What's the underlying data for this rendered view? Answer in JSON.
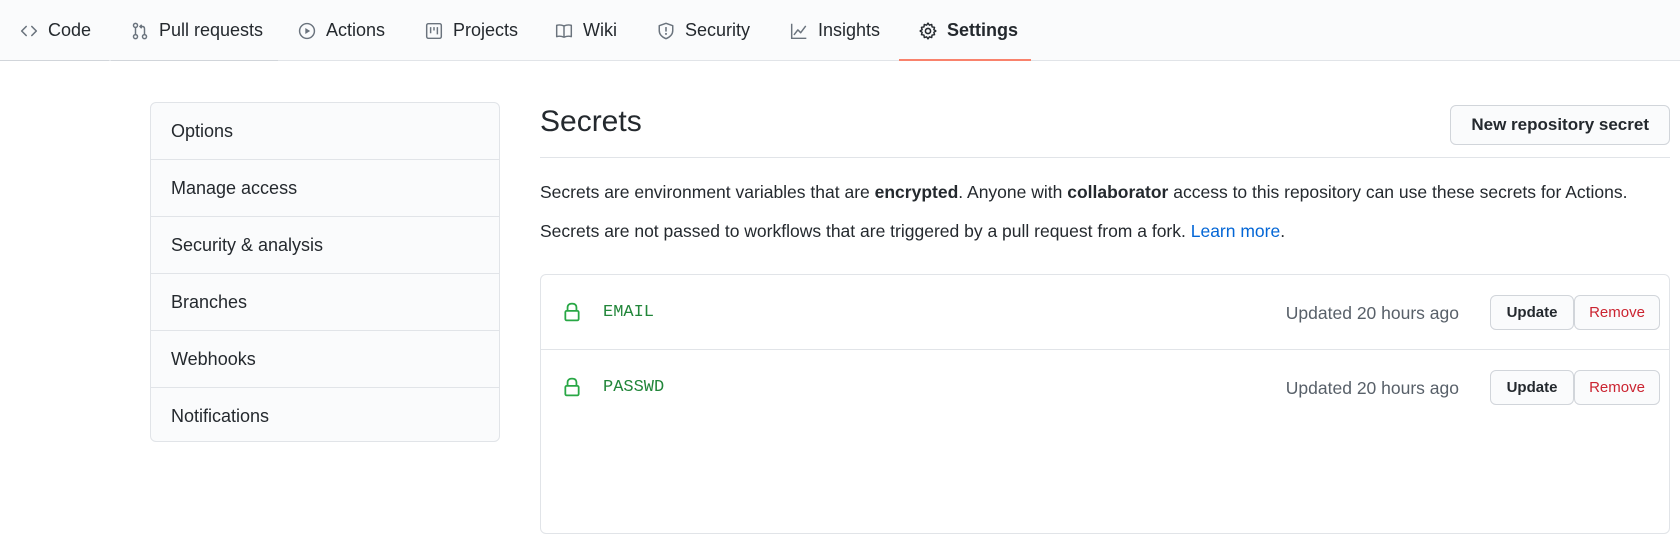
{
  "nav": {
    "tabs": [
      {
        "label": "Code",
        "icon": "code-icon"
      },
      {
        "label": "Pull requests",
        "icon": "git-pull-request-icon"
      },
      {
        "label": "Actions",
        "icon": "play-icon"
      },
      {
        "label": "Projects",
        "icon": "project-icon"
      },
      {
        "label": "Wiki",
        "icon": "book-icon"
      },
      {
        "label": "Security",
        "icon": "shield-icon"
      },
      {
        "label": "Insights",
        "icon": "graph-icon"
      },
      {
        "label": "Settings",
        "icon": "gear-icon"
      }
    ],
    "active_tab": "Settings",
    "active_color": "#f9826c"
  },
  "sidebar": {
    "items": [
      {
        "label": "Options"
      },
      {
        "label": "Manage access"
      },
      {
        "label": "Security & analysis"
      },
      {
        "label": "Branches"
      },
      {
        "label": "Webhooks"
      },
      {
        "label": "Notifications"
      }
    ]
  },
  "main": {
    "title": "Secrets",
    "new_button": "New repository secret",
    "para1": {
      "t1": "Secrets are environment variables that are ",
      "b1": "encrypted",
      "t2": ". Anyone with ",
      "b2": "collaborator",
      "t3": " access to this repository can use these secrets for Actions."
    },
    "para2": {
      "text": "Secrets are not passed to workflows that are triggered by a pull request from a fork. ",
      "link": "Learn more",
      "end": "."
    },
    "secrets": [
      {
        "name": "EMAIL",
        "updated": "Updated 20 hours ago",
        "update_label": "Update",
        "remove_label": "Remove",
        "icon": "lock-icon"
      },
      {
        "name": "PASSWD",
        "updated": "Updated 20 hours ago",
        "update_label": "Update",
        "remove_label": "Remove",
        "icon": "lock-icon"
      }
    ],
    "colors": {
      "link": "#0366d6",
      "secret_name": "#22863a",
      "remove": "#cb2431"
    }
  }
}
